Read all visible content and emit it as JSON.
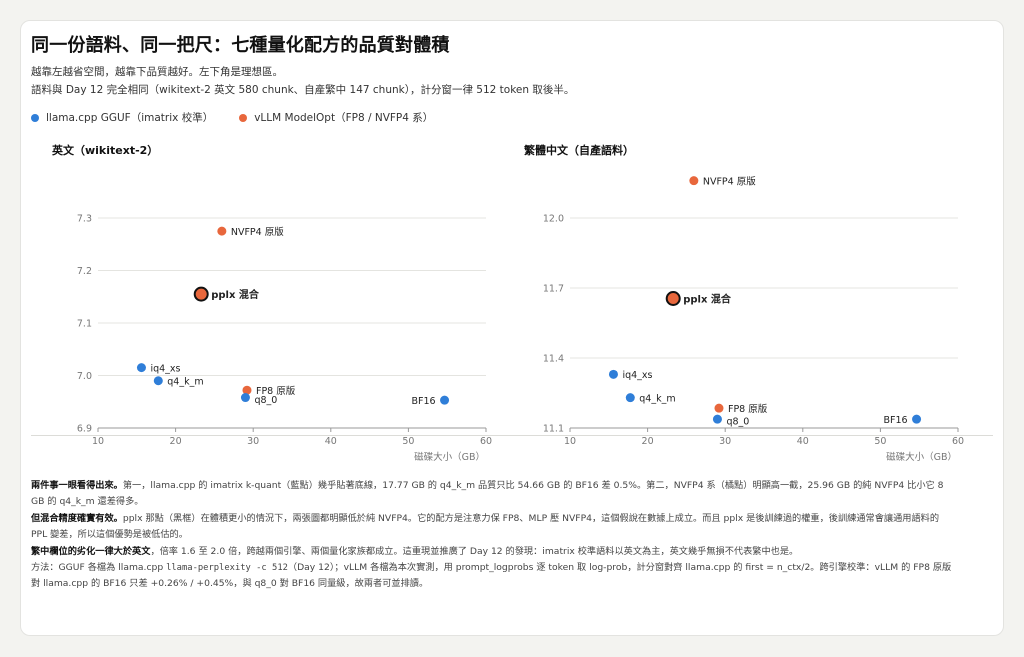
{
  "title": "同一份語料、同一把尺：七種量化配方的品質對體積",
  "subtitle_1": "越靠左越省空間，越靠下品質越好。左下角是理想區。",
  "subtitle_2": "語料與 Day 12 完全相同（wikitext-2 英文 580 chunk、自產繁中 147 chunk），計分窗一律 512 token 取後半。",
  "legend": [
    {
      "label": "llama.cpp GGUF（imatrix 校準）",
      "color": "#2f7ed8"
    },
    {
      "label": "vLLM ModelOpt（FP8 / NVFP4 系）",
      "color": "#e8673c"
    }
  ],
  "colors": {
    "blue": "#2f7ed8",
    "orange": "#e8673c",
    "grid": "#e4e4e0",
    "axis": "#777777"
  },
  "chart_data": [
    {
      "type": "scatter",
      "title": "英文（wikitext-2）",
      "xlabel": "磁碟大小（GB）",
      "ylabel": "",
      "xlim": [
        10,
        60
      ],
      "ylim": [
        6.9,
        7.3
      ],
      "xticks": [
        10,
        20,
        30,
        40,
        50,
        60
      ],
      "yticks": [
        6.9,
        7.0,
        7.1,
        7.2,
        7.3
      ],
      "tick_decimals": 1,
      "grid": true,
      "points": [
        {
          "label": "NVFP4 原版",
          "x": 25.96,
          "y": 7.275,
          "color": "orange",
          "highlight": false,
          "label_pos": "right"
        },
        {
          "label": "pplx 混合",
          "x": 23.3,
          "y": 7.155,
          "color": "orange",
          "highlight": true,
          "label_pos": "right"
        },
        {
          "label": "iq4_xs",
          "x": 15.6,
          "y": 7.015,
          "color": "blue",
          "highlight": false,
          "label_pos": "right"
        },
        {
          "label": "q4_k_m",
          "x": 17.77,
          "y": 6.99,
          "color": "blue",
          "highlight": false,
          "label_pos": "right"
        },
        {
          "label": "FP8 原版",
          "x": 29.2,
          "y": 6.972,
          "color": "orange",
          "highlight": false,
          "label_pos": "right"
        },
        {
          "label": "q8_0",
          "x": 29.0,
          "y": 6.958,
          "color": "blue",
          "highlight": false,
          "label_pos": "right-below"
        },
        {
          "label": "BF16",
          "x": 54.66,
          "y": 6.953,
          "color": "blue",
          "highlight": false,
          "label_pos": "left"
        }
      ]
    },
    {
      "type": "scatter",
      "title": "繁體中文（自產語料）",
      "xlabel": "磁碟大小（GB）",
      "ylabel": "",
      "xlim": [
        10,
        60
      ],
      "ylim": [
        11.1,
        12.0
      ],
      "xticks": [
        10,
        20,
        30,
        40,
        50,
        60
      ],
      "yticks": [
        11.1,
        11.4,
        11.7,
        12.0
      ],
      "tick_decimals": 1,
      "grid": true,
      "points": [
        {
          "label": "NVFP4 原版",
          "x": 25.96,
          "y": 12.16,
          "color": "orange",
          "highlight": false,
          "label_pos": "right"
        },
        {
          "label": "pplx 混合",
          "x": 23.3,
          "y": 11.655,
          "color": "orange",
          "highlight": true,
          "label_pos": "right"
        },
        {
          "label": "iq4_xs",
          "x": 15.6,
          "y": 11.33,
          "color": "blue",
          "highlight": false,
          "label_pos": "right"
        },
        {
          "label": "q4_k_m",
          "x": 17.77,
          "y": 11.23,
          "color": "blue",
          "highlight": false,
          "label_pos": "right"
        },
        {
          "label": "FP8 原版",
          "x": 29.2,
          "y": 11.185,
          "color": "orange",
          "highlight": false,
          "label_pos": "right"
        },
        {
          "label": "q8_0",
          "x": 29.0,
          "y": 11.138,
          "color": "blue",
          "highlight": false,
          "label_pos": "right-below"
        },
        {
          "label": "BF16",
          "x": 54.66,
          "y": 11.138,
          "color": "blue",
          "highlight": false,
          "label_pos": "left"
        }
      ]
    }
  ],
  "notes": {
    "p1_bold": "兩件事一眼看得出來。",
    "p1_text": "第一，llama.cpp 的 imatrix k-quant（藍點）幾乎貼著底線，17.77 GB 的 q4_k_m 品質只比 54.66 GB 的 BF16 差 0.5%。第二，NVFP4 系（橘點）明顯高一截，25.96 GB 的純 NVFP4 比小它 8 GB 的 q4_k_m 還差得多。",
    "p2_bold": "但混合精度確實有效。",
    "p2_text": "pplx 那點（黑框）在體積更小的情況下，兩張圖都明顯低於純 NVFP4。它的配方是注意力保 FP8、MLP 壓 NVFP4，這個假說在數據上成立。而且 pplx 是後訓練過的權重，後訓練通常會讓通用語料的 PPL 變差，所以這個優勢是被低估的。",
    "p3_bold": "繁中欄位的劣化一律大於英文",
    "p3_text": "，倍率 1.6 至 2.0 倍，跨越兩個引擎、兩個量化家族都成立。這重現並推廣了 Day 12 的發現：imatrix 校準語料以英文為主，英文幾乎無損不代表繁中也是。",
    "p4_pre": "方法：GGUF 各檔為 llama.cpp ",
    "p4_code": "llama-perplexity -c 512",
    "p4_post": "（Day 12）；vLLM 各檔為本次實測，用 prompt_logprobs 逐 token 取 log-prob，計分窗對齊 llama.cpp 的 first = n_ctx/2。跨引擎校準：vLLM 的 FP8 原版對 llama.cpp 的 BF16 只差 +0.26% / +0.45%，與 q8_0 對 BF16 同量級，故兩者可並排讀。"
  }
}
